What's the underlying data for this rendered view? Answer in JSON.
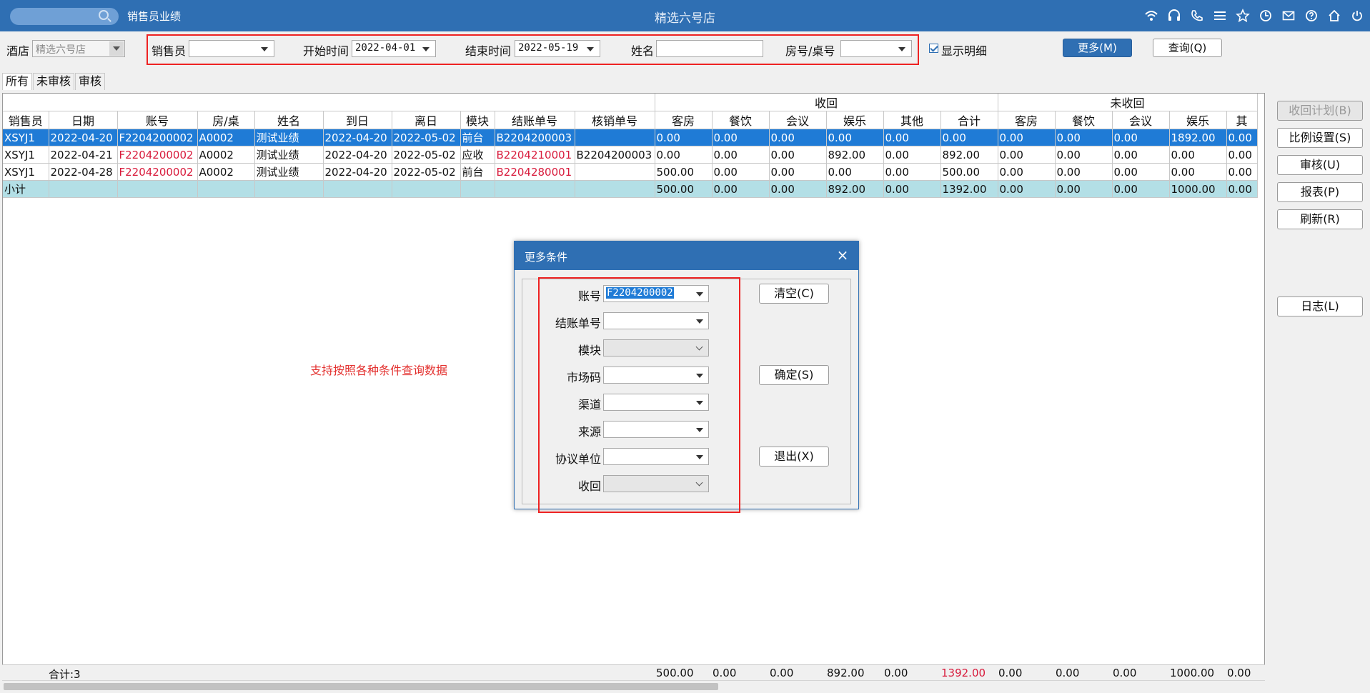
{
  "titlebar": {
    "module": "销售员业绩",
    "store": "精选六号店",
    "icons": [
      "wifi-icon",
      "headset-icon",
      "phone-icon",
      "menu-icon",
      "star-icon",
      "clock-icon",
      "mail-icon",
      "help-icon",
      "home-icon",
      "power-icon"
    ]
  },
  "filters": {
    "hotel_label": "酒店",
    "hotel_value": "精选六号店",
    "sales_label": "销售员",
    "sales_value": "",
    "start_label": "开始时间",
    "start_value": "2022-04-01",
    "end_label": "结束时间",
    "end_value": "2022-05-19",
    "name_label": "姓名",
    "name_value": "",
    "room_label": "房号/桌号",
    "room_value": "",
    "detail_label": "显示明细",
    "more_label": "更多(M)",
    "query_label": "查询(Q)"
  },
  "tabs": [
    "所有",
    "未审核",
    "审核"
  ],
  "grid": {
    "group_recovered": "收回",
    "group_unrecovered": "未收回",
    "columns": [
      "销售员",
      "日期",
      "账号",
      "房/桌",
      "姓名",
      "到日",
      "离日",
      "模块",
      "结账单号",
      "核销单号",
      "客房",
      "餐饮",
      "会议",
      "娱乐",
      "其他",
      "合计",
      "客房",
      "餐饮",
      "会议",
      "娱乐",
      "其"
    ],
    "rows": [
      [
        "XSYJ1",
        "2022-04-20",
        "F2204200002",
        "A0002",
        "测试业绩",
        "2022-04-20",
        "2022-05-02",
        "前台",
        "B2204200003",
        "",
        "0.00",
        "0.00",
        "0.00",
        "0.00",
        "0.00",
        "0.00",
        "0.00",
        "0.00",
        "0.00",
        "1892.00",
        "0.00"
      ],
      [
        "XSYJ1",
        "2022-04-21",
        "F2204200002",
        "A0002",
        "测试业绩",
        "2022-04-20",
        "2022-05-02",
        "应收",
        "B2204210001",
        "B2204200003",
        "0.00",
        "0.00",
        "0.00",
        "892.00",
        "0.00",
        "892.00",
        "0.00",
        "0.00",
        "0.00",
        "0.00",
        "0.00"
      ],
      [
        "XSYJ1",
        "2022-04-28",
        "F2204200002",
        "A0002",
        "测试业绩",
        "2022-04-20",
        "2022-05-02",
        "前台",
        "B2204280001",
        "",
        "500.00",
        "0.00",
        "0.00",
        "0.00",
        "0.00",
        "500.00",
        "0.00",
        "0.00",
        "0.00",
        "0.00",
        "0.00"
      ],
      [
        "小计",
        "",
        "",
        "",
        "",
        "",
        "",
        "",
        "",
        "",
        "500.00",
        "0.00",
        "0.00",
        "892.00",
        "0.00",
        "1392.00",
        "0.00",
        "0.00",
        "0.00",
        "1000.00",
        "0.00"
      ]
    ],
    "totals": {
      "count_label": "合计:3",
      "values": [
        "500.00",
        "0.00",
        "0.00",
        "892.00",
        "0.00",
        "1392.00",
        "0.00",
        "0.00",
        "0.00",
        "1000.00",
        "0.00"
      ]
    }
  },
  "side_buttons": [
    "收回计划(B)",
    "比例设置(S)",
    "审核(U)",
    "报表(P)",
    "刷新(R)",
    "日志(L)"
  ],
  "annotation": "支持按照各种条件查询数据",
  "dialog": {
    "title": "更多条件",
    "fields": [
      {
        "label": "账号",
        "value": "F2204200002"
      },
      {
        "label": "结账单号",
        "value": ""
      },
      {
        "label": "模块",
        "value": ""
      },
      {
        "label": "市场码",
        "value": ""
      },
      {
        "label": "渠道",
        "value": ""
      },
      {
        "label": "来源",
        "value": ""
      },
      {
        "label": "协议单位",
        "value": ""
      },
      {
        "label": "收回",
        "value": ""
      }
    ],
    "clear_label": "清空(C)",
    "ok_label": "确定(S)",
    "exit_label": "退出(X)"
  },
  "colors": {
    "titlebar": "#2f6fb3",
    "selected_row": "#1f7bd6",
    "subtotal_row": "#b3dfe6",
    "account_red": "#d81b3c",
    "highlight_red": "#e22222"
  }
}
